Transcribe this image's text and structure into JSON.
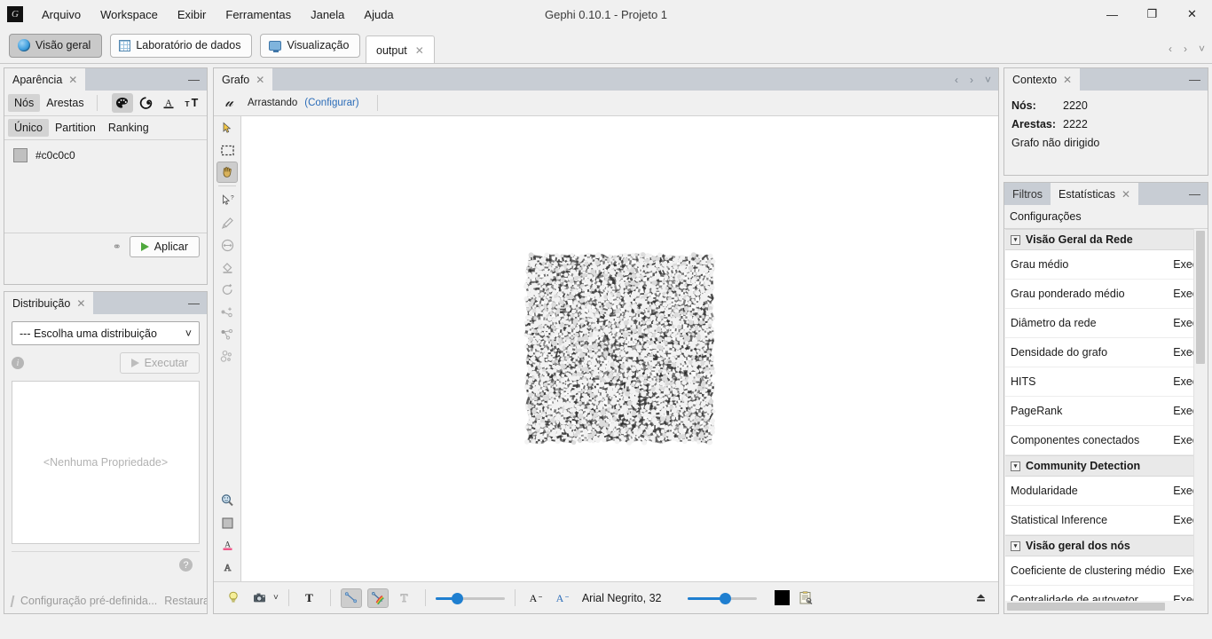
{
  "window": {
    "title": "Gephi 0.10.1 - Projeto 1",
    "app_icon": "gephi-logo-icon",
    "minimize": "—",
    "maximize": "❐",
    "close": "✕"
  },
  "menu": {
    "items": [
      {
        "label": "Arquivo"
      },
      {
        "label": "Workspace"
      },
      {
        "label": "Exibir"
      },
      {
        "label": "Ferramentas"
      },
      {
        "label": "Janela"
      },
      {
        "label": "Ajuda"
      }
    ]
  },
  "modebar": {
    "buttons": [
      {
        "label": "Visão geral",
        "icon": "globe-icon",
        "active": true
      },
      {
        "label": "Laboratório de dados",
        "icon": "table-icon",
        "active": false
      },
      {
        "label": "Visualização",
        "icon": "monitor-icon",
        "active": false
      }
    ]
  },
  "workspace": {
    "tab_label": "output",
    "close_glyph": "✕",
    "nav_prev": "‹",
    "nav_next": "›",
    "nav_list": "˅"
  },
  "appearance": {
    "title": "Aparência",
    "close_glyph": "✕",
    "minimize_glyph": "—",
    "element_tabs": [
      {
        "label": "Nós",
        "active": true
      },
      {
        "label": "Arestas",
        "active": false
      }
    ],
    "mode_icons": [
      {
        "name": "palette-icon",
        "active": true
      },
      {
        "name": "node-size-icon",
        "active": false
      },
      {
        "name": "label-color-icon",
        "active": false
      },
      {
        "name": "label-size-icon",
        "active": false
      }
    ],
    "partition_tabs": [
      {
        "label": "Único",
        "active": true
      },
      {
        "label": "Partition",
        "active": false
      },
      {
        "label": "Ranking",
        "active": false
      }
    ],
    "color_value": "#c0c0c0",
    "chain_icon": "link-icon",
    "apply_label": "Aplicar"
  },
  "layout": {
    "title": "Distribuição",
    "close_glyph": "✕",
    "minimize_glyph": "—",
    "select_value": "--- Escolha uma distribuição",
    "select_chevron": "˅",
    "info_icon": "info-icon",
    "run_label": "Executar",
    "properties_placeholder": "<Nenhuma Propriedade>",
    "help_glyph": "?",
    "preset_label": "Configuração pré-definida...",
    "reset_label": "Restaurar"
  },
  "graph": {
    "tab_label": "Grafo",
    "close_glyph": "✕",
    "nav_prev": "‹",
    "nav_next": "›",
    "nav_list": "˅",
    "logo": "gephi-script-logo",
    "drag_label": "Arrastando",
    "config_link": "(Configurar)",
    "tools": [
      {
        "name": "select-cursor-tool"
      },
      {
        "name": "rectangle-selection-tool"
      },
      {
        "name": "drag-hand-tool",
        "active": true
      },
      {
        "name": "node-info-tool"
      },
      {
        "name": "brush-paint-tool"
      },
      {
        "name": "node-size-tool"
      },
      {
        "name": "paint-bucket-tool"
      },
      {
        "name": "rotate-tool"
      },
      {
        "name": "add-node-tool"
      },
      {
        "name": "add-edge-tool"
      },
      {
        "name": "heatmap-tool"
      }
    ],
    "bottom_tools": [
      {
        "name": "zoom-magnifier-tool"
      },
      {
        "name": "background-color-tool"
      },
      {
        "name": "label-color-tool"
      },
      {
        "name": "label-outline-tool"
      }
    ],
    "toolbar": {
      "lightbulb": "lightbulb-icon",
      "screenshot": "camera-icon",
      "screenshot_chevron": "˅",
      "node_labels": "bold-T-icon",
      "edges": "edge-icon",
      "edge_color": "edge-rainbow-icon",
      "edge_labels": "outline-T-icon",
      "size_slider_pct": 28,
      "font_decrease": "A-minus-icon",
      "font_increase": "A-plus-icon",
      "font_label": "Arial Negrito, 32",
      "label_slider_pct": 55,
      "label_color": "#000000",
      "label_attrs": "label-attributes-icon",
      "export_icon": "export-icon"
    }
  },
  "context": {
    "title": "Contexto",
    "close_glyph": "✕",
    "minimize_glyph": "—",
    "nodes_label": "Nós:",
    "nodes_value": "2220",
    "edges_label": "Arestas:",
    "edges_value": "2222",
    "graph_type": "Grafo não dirigido"
  },
  "statistics": {
    "tabs": [
      {
        "label": "Filtros",
        "active": false
      },
      {
        "label": "Estatísticas",
        "active": true
      }
    ],
    "close_glyph": "✕",
    "minimize_glyph": "—",
    "settings_label": "Configurações",
    "exec_label": "Execu",
    "groups": [
      {
        "title": "Visão Geral da Rede",
        "collapse_glyph": "▾",
        "items": [
          {
            "label": "Grau médio"
          },
          {
            "label": "Grau ponderado médio"
          },
          {
            "label": "Diâmetro da rede"
          },
          {
            "label": "Densidade do grafo"
          },
          {
            "label": "HITS"
          },
          {
            "label": "PageRank"
          },
          {
            "label": "Componentes conectados"
          }
        ]
      },
      {
        "title": "Community Detection",
        "collapse_glyph": "▾",
        "items": [
          {
            "label": "Modularidade"
          },
          {
            "label": "Statistical Inference"
          }
        ]
      },
      {
        "title": "Visão geral dos nós",
        "collapse_glyph": "▾",
        "items": [
          {
            "label": "Coeficiente de clustering médio"
          },
          {
            "label": "Centralidade de autovetor"
          }
        ]
      }
    ]
  }
}
